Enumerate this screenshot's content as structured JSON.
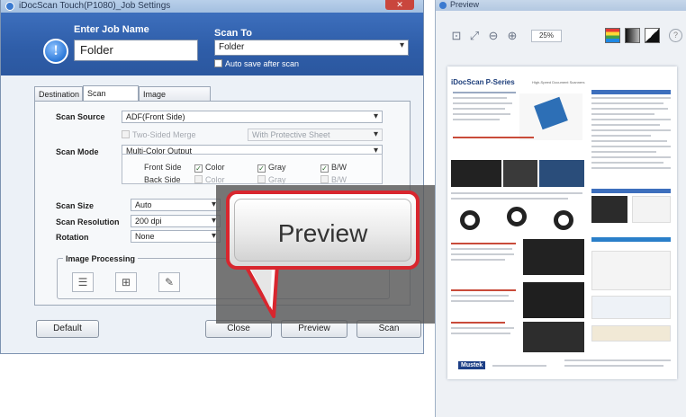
{
  "dialog": {
    "title": "iDocScan Touch(P1080)_Job Settings",
    "job_name_label": "Enter Job Name",
    "job_name_value": "Folder",
    "scan_to_label": "Scan To",
    "scan_to_value": "Folder",
    "auto_save_label": "Auto save after scan"
  },
  "tabs": [
    {
      "label": "Destination"
    },
    {
      "label": "Scan Settings",
      "active": true
    },
    {
      "label": "Image Adjustments"
    }
  ],
  "settings": {
    "scan_source_label": "Scan Source",
    "scan_source_value": "ADF(Front Side)",
    "two_sided_merge_label": "Two-Sided Merge",
    "merge_option_value": "With Protective Sheet",
    "scan_mode_label": "Scan Mode",
    "scan_mode_value": "Multi-Color Output",
    "front_side_label": "Front Side",
    "back_side_label": "Back Side",
    "color_label": "Color",
    "gray_label": "Gray",
    "bw_label": "B/W",
    "scan_size_label": "Scan Size",
    "scan_size_value": "Auto",
    "scan_resolution_label": "Scan Resolution",
    "scan_resolution_value": "200 dpi",
    "rotation_label": "Rotation",
    "rotation_value": "None",
    "image_processing_label": "Image Processing"
  },
  "buttons": {
    "default": "Default",
    "close": "Close",
    "preview": "Preview",
    "scan": "Scan"
  },
  "callout": {
    "label": "Preview",
    "border_color": "#d8262e"
  },
  "preview_window": {
    "title": "Preview",
    "zoom": "25%",
    "help": "?"
  },
  "document": {
    "title": "iDocScan P-Series",
    "subtitle": "High-Speed Document Scanners",
    "logo": "Mustek"
  },
  "colors": {
    "header_blue": "#2f5ea9",
    "accent_red": "#d8262e"
  }
}
